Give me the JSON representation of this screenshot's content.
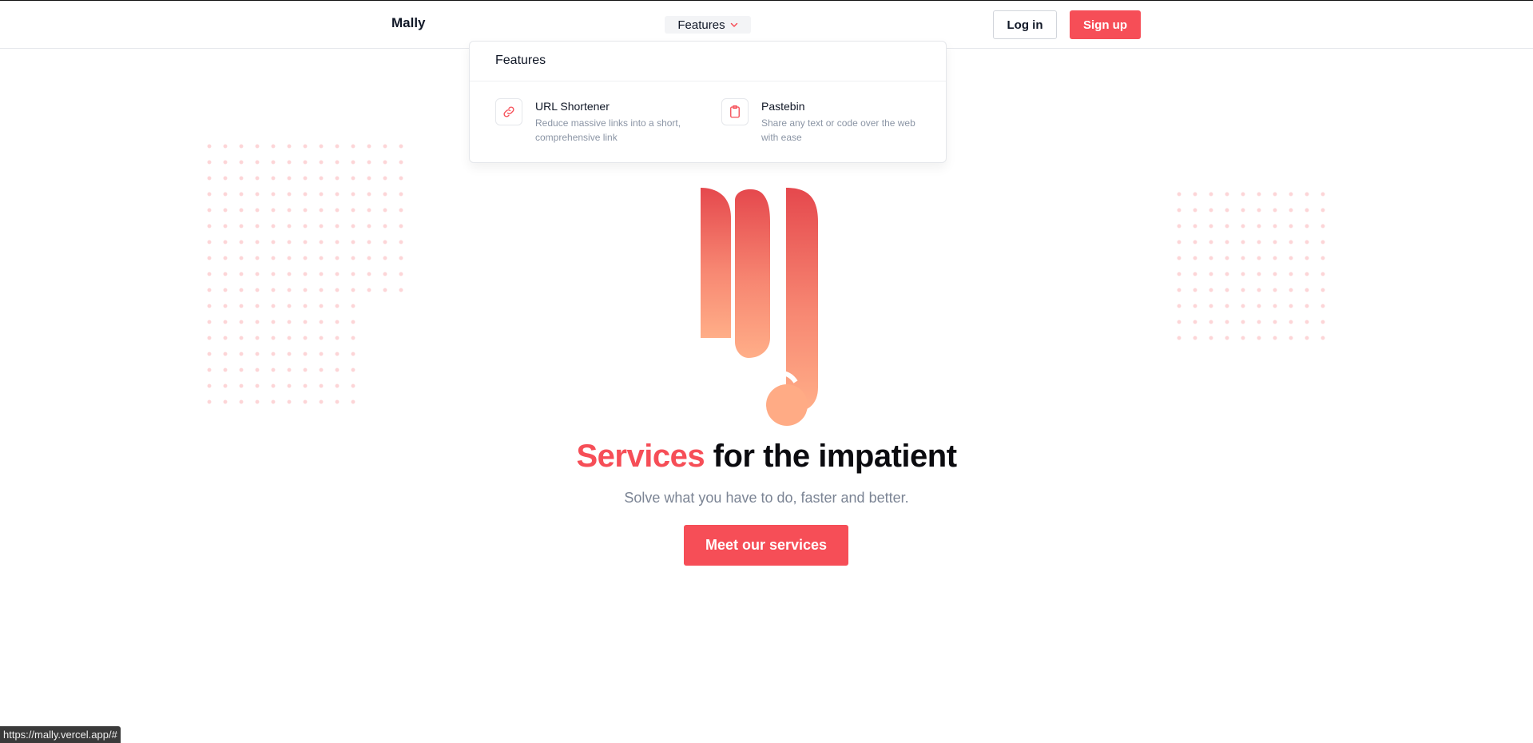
{
  "header": {
    "brand": "Mally",
    "features_label": "Features",
    "login_label": "Log in",
    "signup_label": "Sign up"
  },
  "dropdown": {
    "title": "Features",
    "items": [
      {
        "name": "URL Shortener",
        "description": "Reduce massive links into a short, comprehensive link",
        "icon": "link-icon"
      },
      {
        "name": "Pastebin",
        "description": "Share any text or code over the web with ease",
        "icon": "clipboard-icon"
      }
    ]
  },
  "hero": {
    "title_accent": "Services",
    "title_rest": " for the impatient",
    "subtitle": "Solve what you have to do, faster and better.",
    "cta_label": "Meet our services"
  },
  "status_bar": {
    "url": "https://mally.vercel.app/#"
  },
  "colors": {
    "accent": "#f64e57",
    "dots": "#fdd5d7",
    "logo_top": "#e5484d",
    "logo_bottom": "#ffaa85"
  }
}
